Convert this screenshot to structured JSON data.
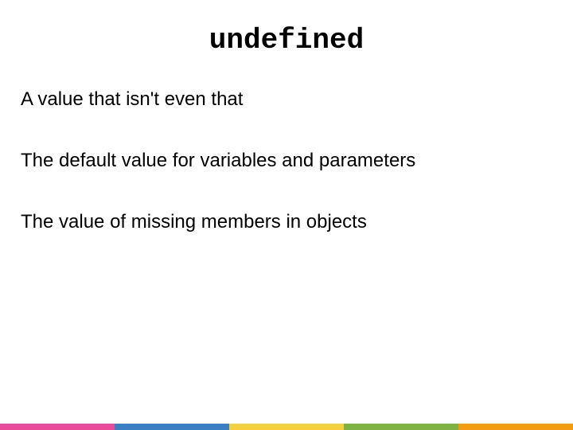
{
  "title": "undefined",
  "points": [
    "A value that isn't even that",
    "The default value for variables and parameters",
    "The value of missing members in objects"
  ],
  "bar_colors": [
    "#e94b9c",
    "#3a7fc4",
    "#f4d03f",
    "#7cb342",
    "#f39c12"
  ]
}
